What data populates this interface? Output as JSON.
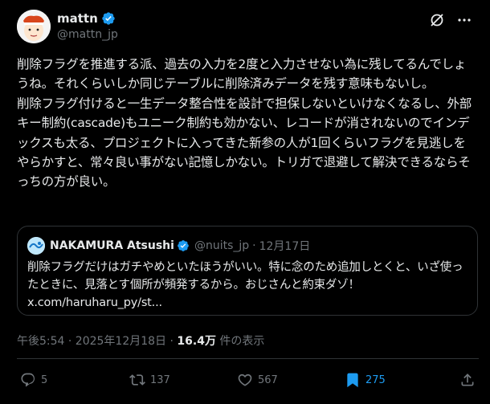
{
  "author": {
    "display_name": "mattn",
    "handle": "@mattn_jp"
  },
  "tweet_text": "削除フラグを推進する派、過去の入力を2度と入力させない為に残してるんでしょうね。それくらいしか同じテーブルに削除済みデータを残す意味もないし。\n削除フラグ付けると一生データ整合性を設計で担保しないといけなくなるし、外部キー制約(cascade)もユニーク制約も効かない、レコードが消されないのでインデックスも太る、プロジェクトに入ってきた新参の人が1回くらいフラグを見逃しをやらかすと、常々良い事がない記憶しかない。トリガで退避して解決できるならそっちの方が良い。",
  "quote": {
    "display_name": "NAKAMURA Atsushi",
    "handle": "@nuits_jp",
    "separator": "·",
    "date": "12月17日",
    "text": "削除フラグだけはガチやめといたほうがいい。特に念のため追加しとくと、いざ使ったときに、見落とす個所が頻発するから。おじさんと約束ダゾ！\nx.com/haruharu_py/st..."
  },
  "meta": {
    "time": "午後5:54 · 2025年12月18日 · ",
    "views": "16.4万",
    "views_suffix": " 件の表示"
  },
  "actions": {
    "replies": "5",
    "retweets": "137",
    "likes": "567",
    "bookmarks": "275"
  },
  "colors": {
    "accent": "#1d9bf0",
    "muted": "#71767b",
    "text": "#e7e9ea",
    "border": "#2f3336"
  },
  "icons": [
    "verified-badge-icon",
    "grok-icon",
    "more-icon",
    "reply-icon",
    "retweet-icon",
    "like-icon",
    "bookmark-icon",
    "share-icon"
  ]
}
